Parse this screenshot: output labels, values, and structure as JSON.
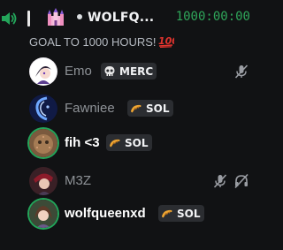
{
  "channel": {
    "name": "WOLFQ...",
    "timer": "1000:00:00",
    "status": "GOAL TO 1000 HOURS!",
    "icons": {
      "speaker": "speaker-icon",
      "divider": "vertical-bar",
      "castle": "castle-emoji-icon",
      "dot": "dot-icon",
      "hundred": "hundred-points-emoji-icon"
    }
  },
  "members": [
    {
      "name": "Emo",
      "tag": "MERC",
      "tag_icon": "skull-icon",
      "name_style": "muted",
      "status_icons": [
        "mic-muted-icon"
      ]
    },
    {
      "name": "Fawniee",
      "tag": "SOL",
      "tag_icon": "croissant-icon",
      "name_style": "muted",
      "status_icons": []
    },
    {
      "name": "fih <3",
      "tag": "SOL",
      "tag_icon": "croissant-icon",
      "name_style": "bold",
      "speaking": true,
      "status_icons": []
    },
    {
      "name": "M3Z",
      "tag": "",
      "name_style": "muted",
      "status_icons": [
        "mic-muted-icon",
        "deafened-icon"
      ]
    },
    {
      "name": "wolfqueenxd",
      "tag": "SOL",
      "tag_icon": "croissant-icon",
      "name_style": "bold",
      "speaking": true,
      "status_icons": []
    }
  ],
  "colors": {
    "background": "#111214",
    "timer_green": "#2fa65a",
    "speaking_ring": "#23a55a",
    "muted_text": "#8e9297",
    "tag_bg": "#2b2d31"
  }
}
